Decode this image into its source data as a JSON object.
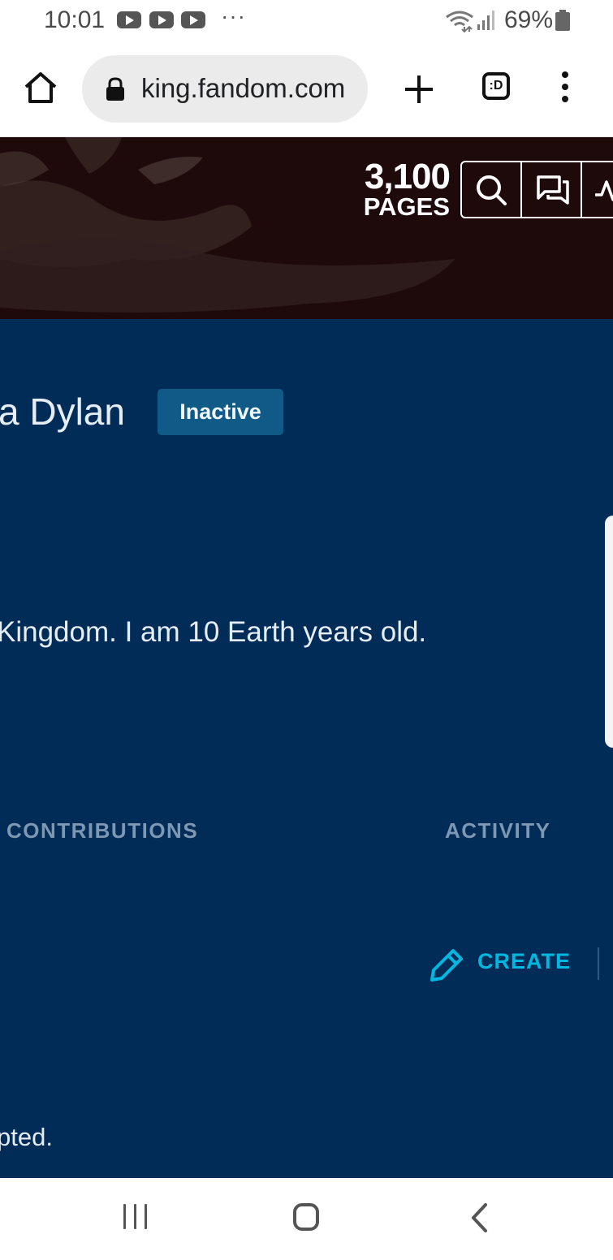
{
  "status_bar": {
    "time": "10:01",
    "more_indicator": "···",
    "battery_percent": "69%",
    "notification_icons": [
      "youtube-icon",
      "youtube-icon",
      "youtube-icon"
    ],
    "right_icons": [
      "wifi-icon",
      "signal-icon",
      "battery-icon"
    ]
  },
  "browser": {
    "url": "king.fandom.com",
    "tab_switcher_label": ":D",
    "icons": [
      "home-icon",
      "lock-icon",
      "plus-icon",
      "tab-switcher-icon",
      "more-vert-icon"
    ]
  },
  "wiki_header": {
    "page_count": "3,100",
    "page_count_label": "PAGES",
    "tool_icons": [
      "search-icon",
      "discussions-icon",
      "activity-icon"
    ]
  },
  "profile": {
    "username": "a Dylan",
    "status_badge": "Inactive",
    "bio": "Kingdom. I am 10 Earth years old."
  },
  "tabs": {
    "contributions": "CONTRIBUTIONS",
    "activity": "ACTIVITY"
  },
  "actions": {
    "create_label": "CREATE",
    "create_icon": "pencil-icon"
  },
  "footer": {
    "text": "pted."
  },
  "colors": {
    "main_background": "#002c57",
    "banner_background": "#1e0a0b",
    "badge_background": "#0f5a86",
    "accent": "#00b7e0",
    "tab_text": "#7e98b3"
  },
  "system_nav": {
    "icons": [
      "recent-apps-icon",
      "home-icon",
      "back-icon"
    ]
  }
}
